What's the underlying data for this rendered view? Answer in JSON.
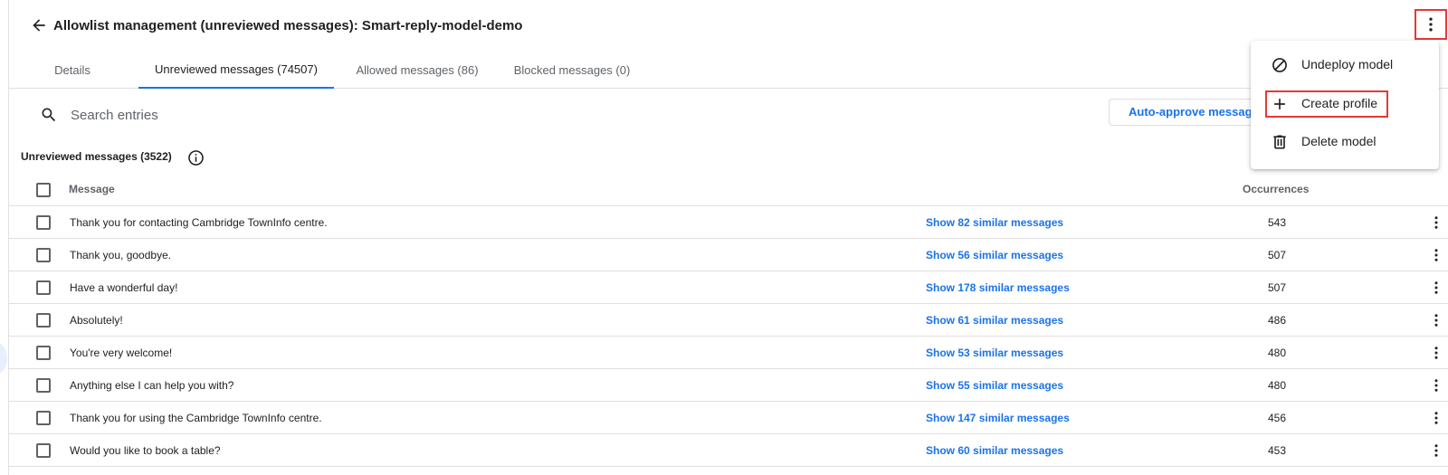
{
  "header": {
    "title": "Allowlist management (unreviewed messages): Smart-reply-model-demo",
    "back_icon": "arrow-back-icon",
    "more_icon": "more-vert-icon",
    "highlight_color": "#e53935"
  },
  "tabs": [
    {
      "label": "Details",
      "active": false
    },
    {
      "label": "Unreviewed messages (74507)",
      "active": true
    },
    {
      "label": "Allowed messages (86)",
      "active": false
    },
    {
      "label": "Blocked messages (0)",
      "active": false
    }
  ],
  "search": {
    "placeholder": "Search entries",
    "value": ""
  },
  "toolbar": {
    "auto_approve_label": "Auto-approve messages"
  },
  "section": {
    "title": "Unreviewed messages (3522)"
  },
  "table": {
    "columns": {
      "message": "Message",
      "occurrences": "Occurrences"
    },
    "rows": [
      {
        "message": "Thank you for contacting Cambridge TownInfo centre.",
        "similar": "Show 82 similar messages",
        "occurrences": "543"
      },
      {
        "message": "Thank you, goodbye.",
        "similar": "Show 56 similar messages",
        "occurrences": "507"
      },
      {
        "message": "Have a wonderful day!",
        "similar": "Show 178 similar messages",
        "occurrences": "507"
      },
      {
        "message": "Absolutely!",
        "similar": "Show 61 similar messages",
        "occurrences": "486"
      },
      {
        "message": "You're very welcome!",
        "similar": "Show 53 similar messages",
        "occurrences": "480"
      },
      {
        "message": "Anything else I can help you with?",
        "similar": "Show 55 similar messages",
        "occurrences": "480"
      },
      {
        "message": "Thank you for using the Cambridge TownInfo centre.",
        "similar": "Show 147 similar messages",
        "occurrences": "456"
      },
      {
        "message": "Would you like to book a table?",
        "similar": "Show 60 similar messages",
        "occurrences": "453"
      }
    ]
  },
  "menu": {
    "items": [
      {
        "label": "Undeploy model",
        "icon": "block-icon"
      },
      {
        "label": "Create profile",
        "icon": "add-icon",
        "highlighted": true
      },
      {
        "label": "Delete model",
        "icon": "trash-icon"
      }
    ]
  },
  "colors": {
    "accent": "#1a73e8",
    "highlight": "#e53935"
  }
}
